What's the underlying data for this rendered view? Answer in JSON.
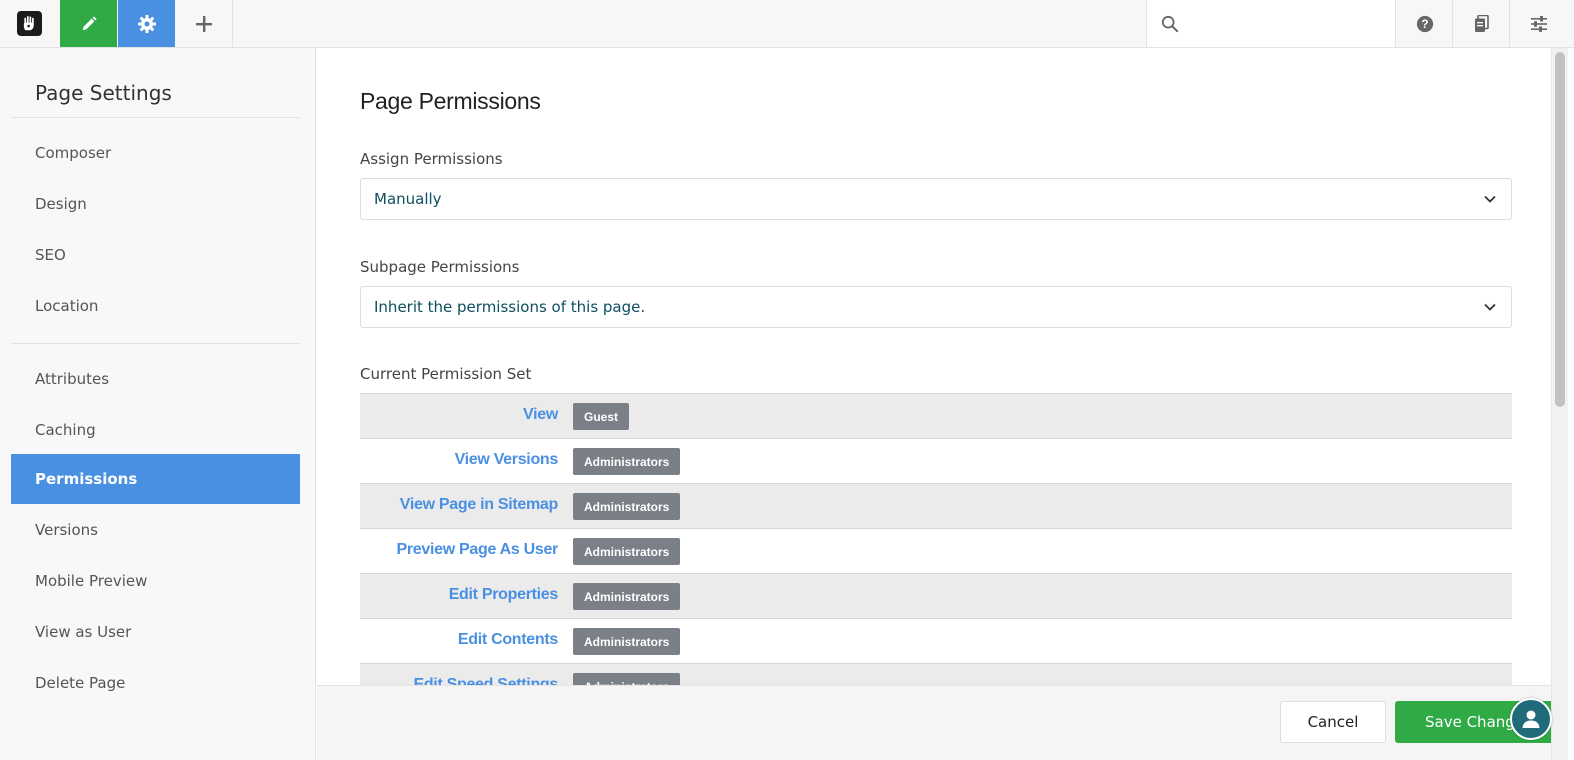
{
  "toolbar": {
    "logo_icon": "hand-logo-icon",
    "edit_icon": "pencil-icon",
    "settings_icon": "gear-icon",
    "add_icon": "plus-icon",
    "search_icon": "search-icon",
    "search_placeholder": "",
    "help_icon": "question-icon",
    "pages_icon": "pages-icon",
    "sliders_icon": "sliders-icon",
    "colors": {
      "edit": "#2faa45",
      "settings": "#4a90e2"
    }
  },
  "sidebar": {
    "title": "Page Settings",
    "items": [
      {
        "label": "Composer"
      },
      {
        "label": "Design"
      },
      {
        "label": "SEO"
      },
      {
        "label": "Location"
      },
      {
        "label": "Attributes"
      },
      {
        "label": "Caching"
      },
      {
        "label": "Permissions",
        "active": true
      },
      {
        "label": "Versions"
      },
      {
        "label": "Mobile Preview"
      },
      {
        "label": "View as User"
      },
      {
        "label": "Delete Page"
      }
    ]
  },
  "main": {
    "title": "Page Permissions",
    "assign": {
      "label": "Assign Permissions",
      "value": "Manually"
    },
    "subpage": {
      "label": "Subpage Permissions",
      "value": "Inherit the permissions of this page."
    },
    "current_set": {
      "label": "Current Permission Set",
      "rows": [
        {
          "name": "View",
          "group": "Guest"
        },
        {
          "name": "View Versions",
          "group": "Administrators"
        },
        {
          "name": "View Page in Sitemap",
          "group": "Administrators"
        },
        {
          "name": "Preview Page As User",
          "group": "Administrators"
        },
        {
          "name": "Edit Properties",
          "group": "Administrators"
        },
        {
          "name": "Edit Contents",
          "group": "Administrators"
        },
        {
          "name": "Edit Speed Settings",
          "group": "Administrators"
        }
      ]
    }
  },
  "footer": {
    "cancel_label": "Cancel",
    "save_label": "Save Changes",
    "avatar_icon": "user-icon"
  }
}
